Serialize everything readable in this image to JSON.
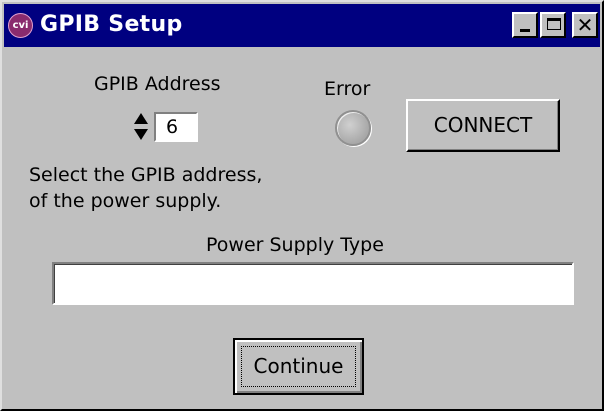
{
  "window": {
    "app_icon": "cvi-logo-icon",
    "title": "GPIB Setup",
    "controls": {
      "minimize_icon": "minimize-icon",
      "maximize_icon": "maximize-icon",
      "close_glyph": "✕"
    },
    "colors": {
      "titlebar": "#000080",
      "face": "#c0c0c0",
      "field": "#ffffff"
    }
  },
  "gpib": {
    "label": "GPIB Address",
    "value": "6",
    "help_line1": "Select the GPIB address,",
    "help_line2": "of the power supply."
  },
  "error": {
    "label": "Error",
    "led_state": "off"
  },
  "connect": {
    "label": "CONNECT"
  },
  "power_supply": {
    "label": "Power Supply Type",
    "value": ""
  },
  "continue": {
    "label": "Continue"
  }
}
